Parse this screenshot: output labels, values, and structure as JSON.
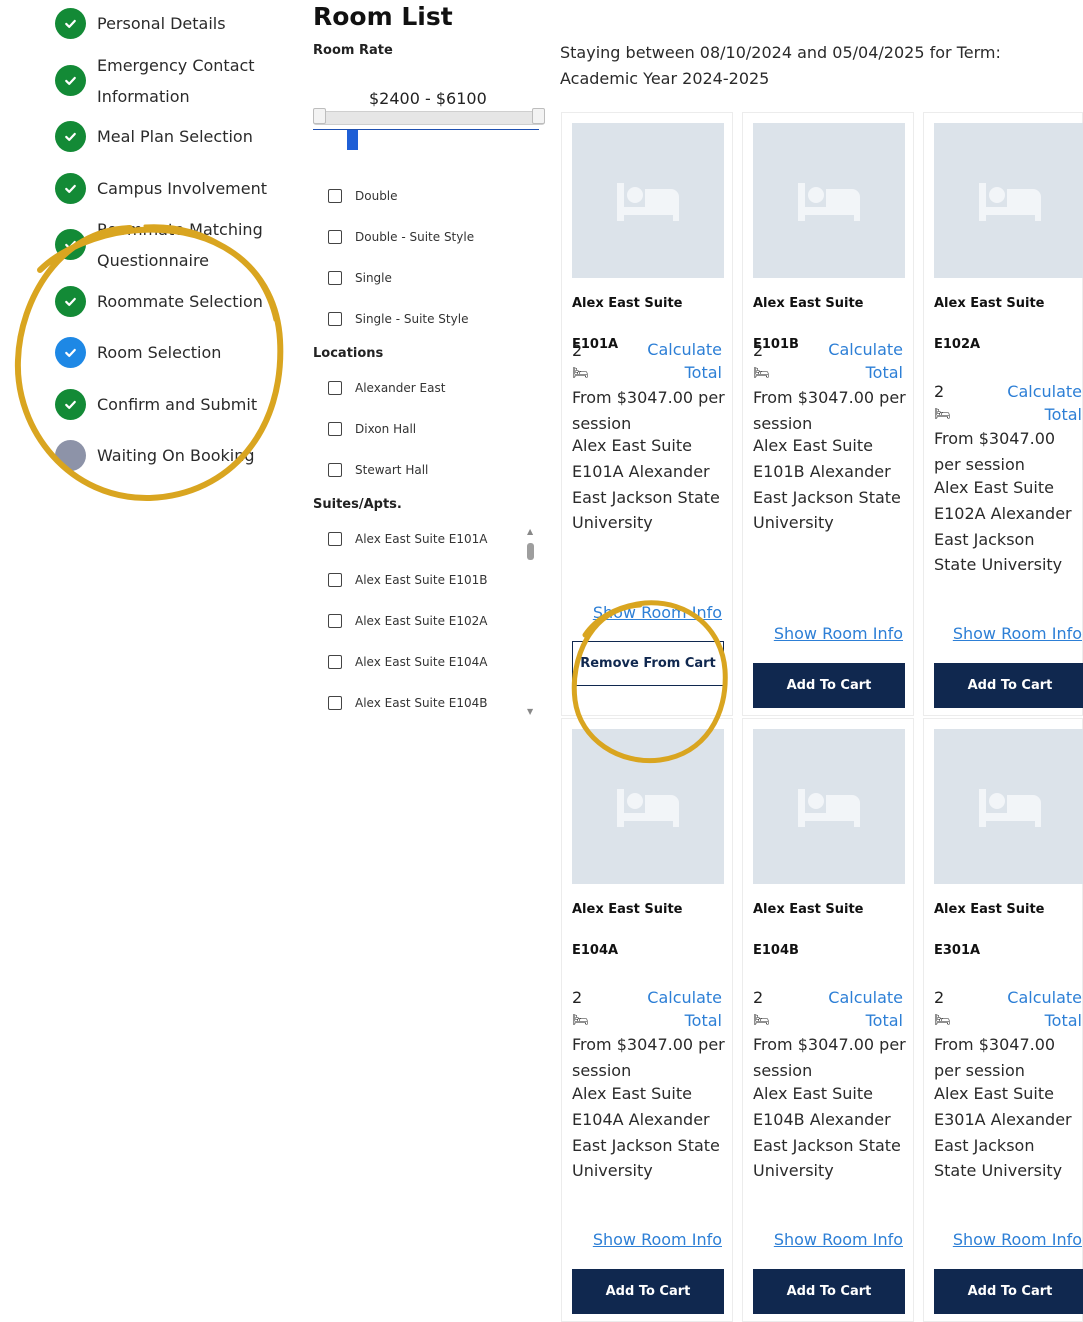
{
  "steps": [
    {
      "label": "Personal Details",
      "status": "done"
    },
    {
      "label": "Emergency Contact Information",
      "status": "done"
    },
    {
      "label": "Meal Plan Selection",
      "status": "done"
    },
    {
      "label": "Campus Involvement",
      "status": "done"
    },
    {
      "label": "Roommate Matching Questionnaire",
      "status": "done"
    },
    {
      "label": "Roommate Selection",
      "status": "done"
    },
    {
      "label": "Room Selection",
      "status": "current"
    },
    {
      "label": "Confirm and Submit",
      "status": "done"
    },
    {
      "label": "Waiting On Booking",
      "status": "pending"
    }
  ],
  "page_title": "Room List",
  "filters": {
    "room_rate_title": "Room Rate",
    "range_display": "$2400 - $6100",
    "room_types": [
      "Double",
      "Double - Suite Style",
      "Single",
      "Single - Suite Style"
    ],
    "locations_title": "Locations",
    "locations": [
      "Alexander East",
      "Dixon Hall",
      "Stewart Hall"
    ],
    "suites_title": "Suites/Apts.",
    "suites": [
      "Alex East Suite E101A",
      "Alex East Suite E101B",
      "Alex East Suite E102A",
      "Alex East Suite E104A",
      "Alex East Suite E104B"
    ]
  },
  "stay_text": "Staying between 08/10/2024 and 05/04/2025 for Term: Academic Year 2024-2025",
  "rooms": [
    {
      "name": "Alex East Suite E101A",
      "capacity": "2",
      "calc_label": "Calculate Total",
      "price": "From $3047.00 per session",
      "details": "Alex East Suite E101A Alexander East Jackson State University",
      "show_info": "Show Room Info",
      "button": "Remove From Cart",
      "in_cart": true
    },
    {
      "name": "Alex East Suite E101B",
      "capacity": "2",
      "calc_label": "Calculate Total",
      "price": "From $3047.00 per session",
      "details": "Alex East Suite E101B Alexander East Jackson State University",
      "show_info": "Show Room Info",
      "button": "Add To Cart",
      "in_cart": false
    },
    {
      "name": "Alex East Suite E102A",
      "capacity": "2",
      "calc_label": "Calculate Total",
      "price": "From $3047.00 per session",
      "details": "Alex East Suite E102A Alexander East Jackson State University",
      "show_info": "Show Room Info",
      "button": "Add To Cart",
      "in_cart": false
    },
    {
      "name": "Alex East Suite E104A",
      "capacity": "2",
      "calc_label": "Calculate Total",
      "price": "From $3047.00 per session",
      "details": "Alex East Suite E104A Alexander East Jackson State University",
      "show_info": "Show Room Info",
      "button": "Add To Cart",
      "in_cart": false
    },
    {
      "name": "Alex East Suite E104B",
      "capacity": "2",
      "calc_label": "Calculate Total",
      "price": "From $3047.00 per session",
      "details": "Alex East Suite E104B Alexander East Jackson State University",
      "show_info": "Show Room Info",
      "button": "Add To Cart",
      "in_cart": false
    },
    {
      "name": "Alex East Suite E301A",
      "capacity": "2",
      "calc_label": "Calculate Total",
      "price": "From $3047.00 per session",
      "details": "Alex East Suite E301A Alexander East Jackson State University",
      "show_info": "Show Room Info",
      "button": "Add To Cart",
      "in_cart": false
    }
  ],
  "colors": {
    "done": "#138a36",
    "current": "#1e88e5",
    "pending": "#8d93a8",
    "button": "#10284f",
    "link": "#2d7fd6",
    "annotation": "#d9a520"
  }
}
